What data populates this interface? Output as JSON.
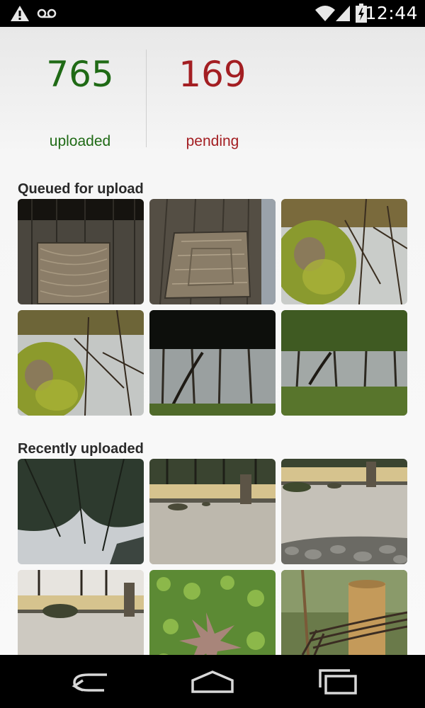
{
  "status_bar": {
    "time": "12:44",
    "left_icons": [
      "warning-icon",
      "voicemail-icon"
    ],
    "right_icons": [
      "wifi-icon",
      "signal-icon",
      "battery-charging-icon"
    ]
  },
  "stats": {
    "uploaded": {
      "count": "765",
      "label": "uploaded",
      "color": "#1f6a15"
    },
    "pending": {
      "count": "169",
      "label": "pending",
      "color": "#a31e22"
    }
  },
  "queued": {
    "title": "Queued for upload",
    "thumbnails": [
      "wood-mat-photo",
      "wood-mat-angled-photo",
      "mossy-rock-photo",
      "mossy-rock-trees-photo",
      "forest-under-eave-photo",
      "forest-moss-eave-photo"
    ]
  },
  "recent": {
    "title": "Recently uploaded",
    "thumbnails": [
      "tree-canopy-photo",
      "zen-garden-photo",
      "zen-garden-stones-photo",
      "zen-garden-wall-photo",
      "moss-maple-leaf-photo",
      "bamboo-rope-photo"
    ]
  },
  "nav_bar": {
    "icons": [
      "back-icon",
      "home-icon",
      "recents-icon"
    ]
  }
}
